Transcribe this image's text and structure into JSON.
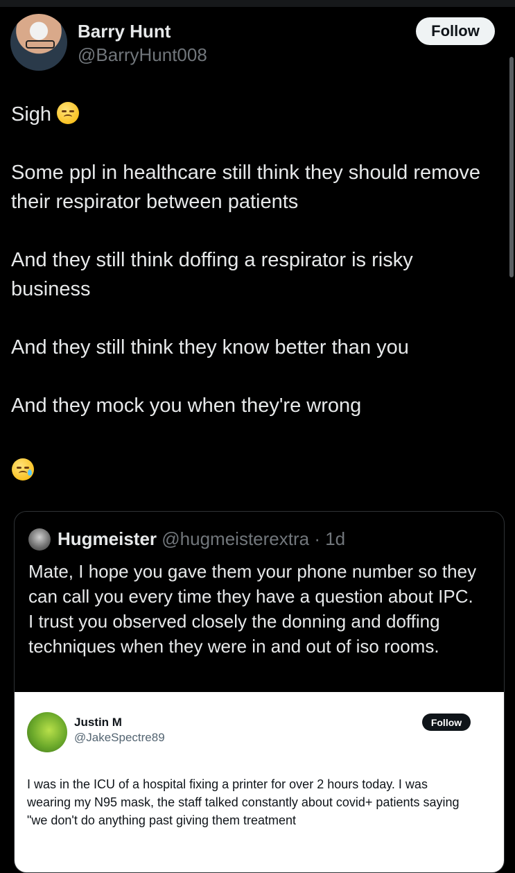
{
  "author": {
    "display_name": "Barry Hunt",
    "handle": "@BarryHunt008",
    "follow_label": "Follow"
  },
  "tweet": {
    "paragraphs": [
      "Sigh",
      "Some ppl in healthcare still think they should remove their respirator between patients",
      "And they still think doffing a respirator is risky business",
      "And they still think they know better than you",
      "And they mock you when they're wrong"
    ],
    "emojis": [
      "pensive-face-emoji",
      "crying-face-emoji"
    ]
  },
  "quote": {
    "display_name": "Hugmeister",
    "meta": "@hugmeisterextra · 1d",
    "text": "Mate, I hope you gave them your phone number so they can call you every time they have a question about IPC.\nI trust you observed closely the donning and doffing techniques when they were in and out of iso rooms.",
    "embedded": {
      "display_name": "Justin M",
      "handle": "@JakeSpectre89",
      "follow_label": "Follow",
      "text": "I was in the ICU of a hospital fixing a printer for over 2 hours today. I was wearing my N95 mask, the staff talked constantly about covid+ patients saying \"we don't do anything past giving them treatment"
    }
  },
  "colors": {
    "background": "#000000",
    "text": "#e7e9ea",
    "muted": "#71767b",
    "follow_bg": "#eff3f4",
    "card_border": "#2f3336"
  }
}
